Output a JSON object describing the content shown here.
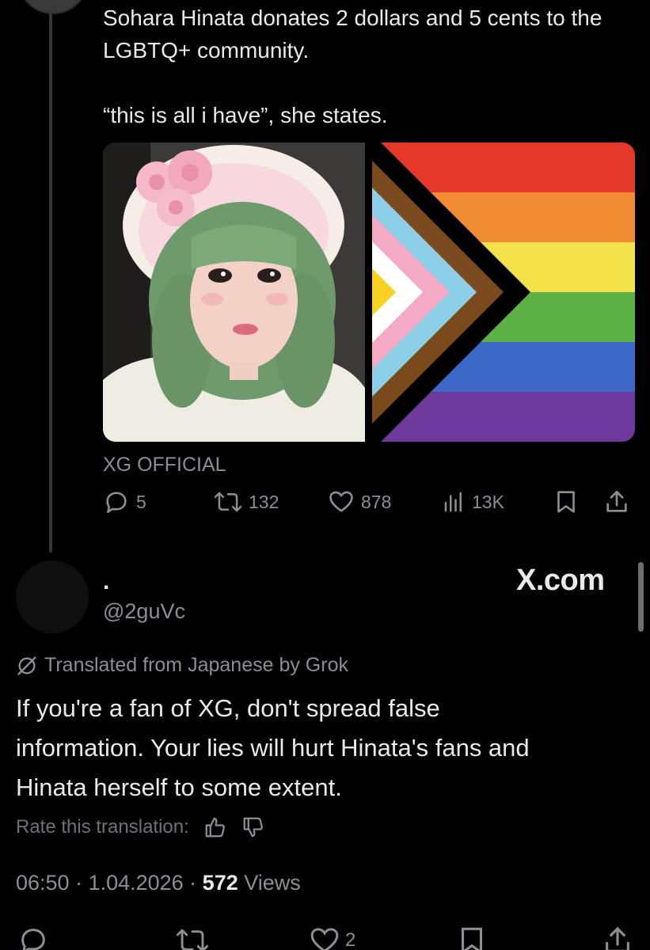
{
  "quoted_tweet": {
    "text_line1": "Sohara Hinata donates 2 dollars and 5 cents to the LGBTQ+ community.",
    "text_line2": "“this is all i have”, she states.",
    "source_label": "XG OFFICIAL",
    "stats": {
      "replies": "5",
      "reposts": "132",
      "likes": "878",
      "views": "13K"
    },
    "flag_colors": [
      "#e53a2b",
      "#f08c33",
      "#f4e24a",
      "#5cb244",
      "#3c68c8",
      "#6d3a9c"
    ],
    "chevron_colors": [
      "#000000",
      "#7a4a1e",
      "#8ecfe8",
      "#f4aac4",
      "#ffffff",
      "#f9d224"
    ]
  },
  "reply": {
    "display_name": ".",
    "handle": "@2guVc",
    "watermark": "X.com",
    "translated_label": "Translated from Japanese by Grok",
    "body_lines": [
      "If you're a fan of XG, don't spread false",
      "information. Your lies will hurt Hinata's fans and",
      "Hinata herself to some extent."
    ],
    "rate_label": "Rate this translation:",
    "time": "06:50 · 1.04.2026 · ",
    "views_count": "572",
    "views_label": " Views",
    "bottom_stats": {
      "likes": "2"
    }
  }
}
